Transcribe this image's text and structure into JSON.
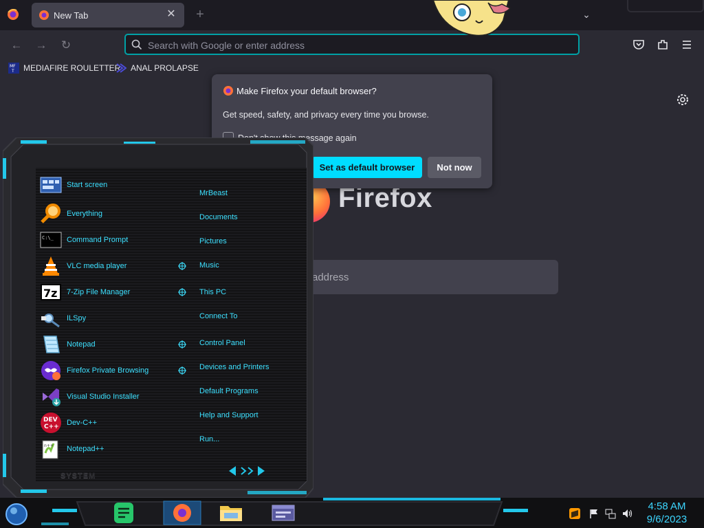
{
  "browser": {
    "tab_title": "New Tab",
    "tab_close": "✕",
    "new_tab": "+",
    "list_all_tabs": "⌄",
    "urlbar_placeholder": "Search with Google or enter address",
    "bookmarks": [
      {
        "label": "MEDIAFIRE ROULETTER",
        "icon": "mediafire-icon"
      },
      {
        "label": "ANAL PROLAPSE",
        "icon": "bookmark-icon"
      }
    ]
  },
  "newtab_page": {
    "logo_text": "Firefox",
    "search_placeholder_visible": "address"
  },
  "popup": {
    "title": "Make Firefox your default browser?",
    "body": "Get speed, safety, and privacy every time you browse.",
    "checkbox_label": "Don't show this message again",
    "primary_button": "Set as default browser",
    "secondary_button": "Not now"
  },
  "start_menu": {
    "programs": [
      {
        "label": "Start screen",
        "icon": "start-screen-icon"
      },
      {
        "label": "Everything",
        "icon": "everything-search-icon"
      },
      {
        "label": "Command Prompt",
        "icon": "command-prompt-icon"
      },
      {
        "label": "VLC media player",
        "icon": "vlc-icon"
      },
      {
        "label": "7-Zip File Manager",
        "icon": "7zip-icon"
      },
      {
        "label": "ILSpy",
        "icon": "ilspy-icon"
      },
      {
        "label": "Notepad",
        "icon": "notepad-icon"
      },
      {
        "label": "Firefox Private Browsing",
        "icon": "firefox-private-icon"
      },
      {
        "label": "Visual Studio Installer",
        "icon": "visual-studio-installer-icon"
      },
      {
        "label": "Dev-C++",
        "icon": "devcpp-icon"
      },
      {
        "label": "Notepad++",
        "icon": "notepadpp-icon"
      }
    ],
    "places": [
      {
        "label": "MrBeast"
      },
      {
        "label": "Documents"
      },
      {
        "label": "Pictures"
      },
      {
        "label": "Music"
      },
      {
        "label": "This PC"
      },
      {
        "label": "Connect To"
      },
      {
        "label": "Control Panel"
      },
      {
        "label": "Devices and Printers"
      },
      {
        "label": "Default Programs"
      },
      {
        "label": "Help and Support"
      },
      {
        "label": "Run..."
      }
    ],
    "system_label": "SYSTEM",
    "accent_color": "#3de0ff"
  },
  "taskbar": {
    "time": "4:58 AM",
    "date": "9/6/2023",
    "pinned": [
      "notes-app-icon",
      "firefox-icon",
      "file-explorer-icon",
      "window-app-icon"
    ],
    "tray": [
      "sublime-icon",
      "flag-icon",
      "network-icon",
      "volume-icon"
    ]
  }
}
